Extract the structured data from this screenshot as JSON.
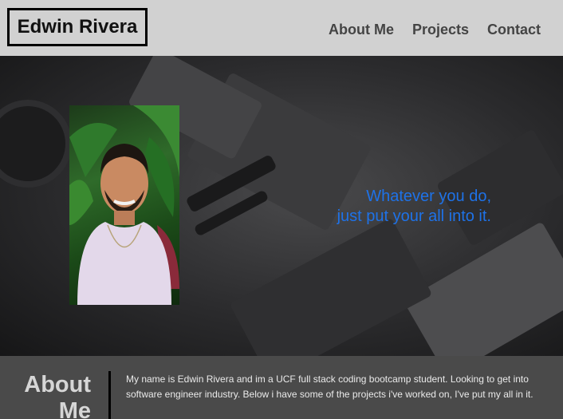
{
  "header": {
    "brand": "Edwin Rivera",
    "nav": [
      {
        "label": "About Me"
      },
      {
        "label": "Projects"
      },
      {
        "label": "Contact"
      }
    ]
  },
  "hero": {
    "quote_line1": "Whatever you do,",
    "quote_line2": "just put your all into it."
  },
  "about": {
    "title_line1": "About",
    "title_line2": "Me",
    "text": "My name is Edwin Rivera and im a UCF full stack coding bootcamp student. Looking to get into software engineer industry. Below i have some of the projects i've worked on, I've put my all in it."
  },
  "colors": {
    "header_bg": "#d1d1d1",
    "quote": "#1e72e8",
    "about_bg": "#4a4a4a"
  }
}
